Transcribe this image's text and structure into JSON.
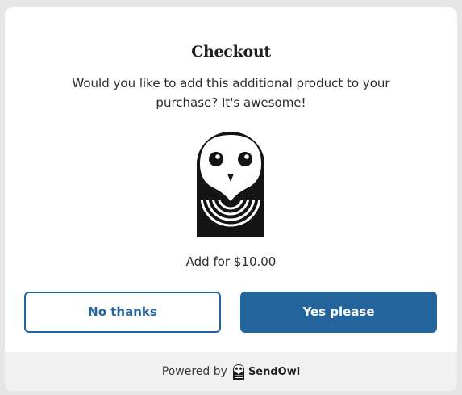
{
  "checkout": {
    "title": "Checkout",
    "message": "Would you like to add this additional product to your purchase? It's awesome!",
    "price_label": "Add for $10.00",
    "product_image_icon": "owl-logo-icon"
  },
  "buttons": {
    "no_label": "No thanks",
    "yes_label": "Yes please"
  },
  "footer": {
    "powered_by": "Powered by",
    "brand_name": "SendOwl",
    "brand_icon": "owl-icon"
  },
  "colors": {
    "accent": "#24649c",
    "footer_bg": "#f1f1f1",
    "backdrop": "#e6e6e6"
  }
}
